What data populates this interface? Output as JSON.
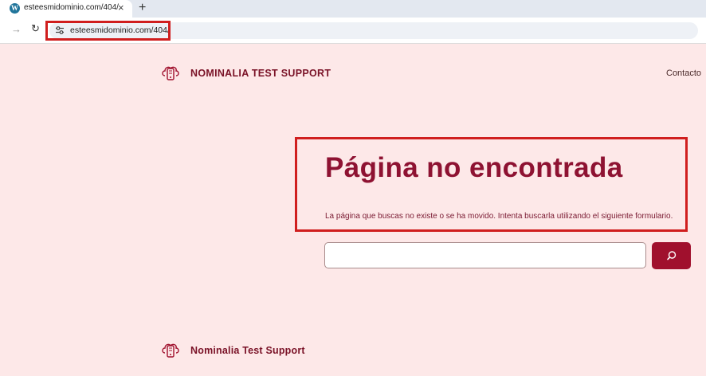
{
  "browser": {
    "tab": {
      "title": "esteesmidominio.com/404/",
      "favicon": "wordpress-icon",
      "close_label": "×"
    },
    "new_tab_label": "+",
    "toolbar": {
      "forward_icon": "→",
      "reload_icon": "↻",
      "site_info_icon": "⚙"
    },
    "url": "esteesmidominio.com/404/"
  },
  "header": {
    "site_title": "NOMINALIA TEST SUPPORT",
    "nav": {
      "contacto": "Contacto"
    }
  },
  "main": {
    "heading": "Página no encontrada",
    "description": "La página que buscas no existe o se ha movido. Intenta buscarla utilizando el siguiente formulario.",
    "search": {
      "placeholder": "",
      "value": "",
      "button_icon": "search-icon"
    }
  },
  "footer": {
    "site_title": "Nominalia Test Support"
  },
  "colors": {
    "brand": "#8e1232",
    "background": "#fde8e8",
    "button": "#a0102d",
    "annotation": "#d01e1e"
  }
}
